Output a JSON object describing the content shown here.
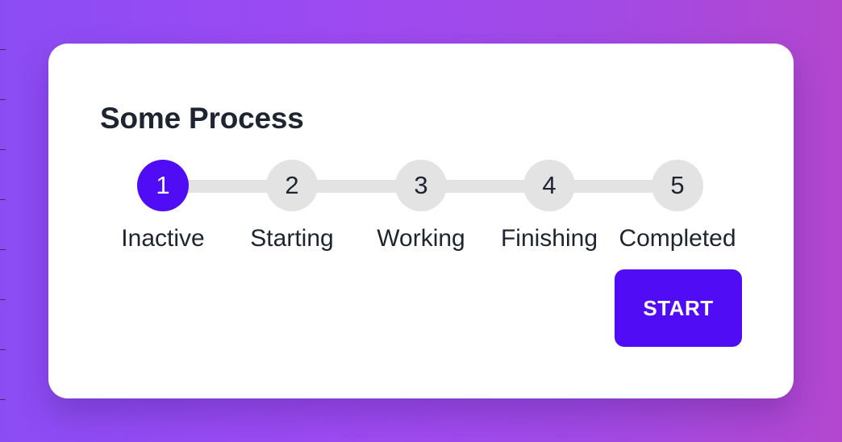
{
  "process": {
    "title": "Some Process",
    "current_step": 1,
    "steps": [
      {
        "number": "1",
        "label": "Inactive"
      },
      {
        "number": "2",
        "label": "Starting"
      },
      {
        "number": "3",
        "label": "Working"
      },
      {
        "number": "4",
        "label": "Finishing"
      },
      {
        "number": "5",
        "label": "Completed"
      }
    ],
    "start_label": "START"
  },
  "colors": {
    "accent": "#4f0cf5",
    "inactive_step": "#e3e3e3",
    "text": "#1e2430",
    "card": "#ffffff",
    "background_start": "#8c4cf4",
    "background_end": "#b347cf"
  }
}
